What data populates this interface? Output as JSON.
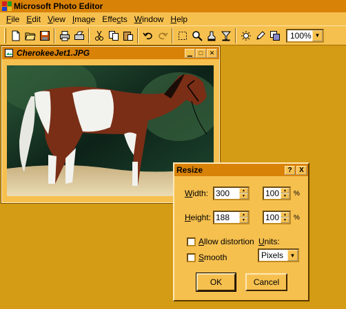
{
  "app": {
    "title": "Microsoft Photo Editor"
  },
  "menu": [
    {
      "pre": "",
      "acc": "F",
      "post": "ile"
    },
    {
      "pre": "",
      "acc": "E",
      "post": "dit"
    },
    {
      "pre": "",
      "acc": "V",
      "post": "iew"
    },
    {
      "pre": "",
      "acc": "I",
      "post": "mage"
    },
    {
      "pre": "Effe",
      "acc": "c",
      "post": "ts"
    },
    {
      "pre": "",
      "acc": "W",
      "post": "indow"
    },
    {
      "pre": "",
      "acc": "H",
      "post": "elp"
    }
  ],
  "toolbar": {
    "zoom": "100%"
  },
  "image_window": {
    "title": "CherokeeJet1.JPG"
  },
  "dialog": {
    "title": "Resize",
    "help_glyph": "?",
    "close_glyph": "X",
    "width_label_acc": "W",
    "width_label_rest": "idth:",
    "height_label_acc": "H",
    "height_label_rest": "eight:",
    "width_value": "300",
    "height_value": "188",
    "width_percent": "100",
    "height_percent": "100",
    "percent_sign": "%",
    "allow_distortion_acc": "A",
    "allow_distortion_rest": "llow distortion",
    "smooth_acc": "S",
    "smooth_rest": "mooth",
    "units_acc": "U",
    "units_rest": "nits:",
    "units_value": "Pixels",
    "ok_label": "OK",
    "cancel_label": "Cancel"
  },
  "colors": {
    "desktop": "#d49b14",
    "title_bar": "#d98208",
    "face": "#f6c04f"
  }
}
